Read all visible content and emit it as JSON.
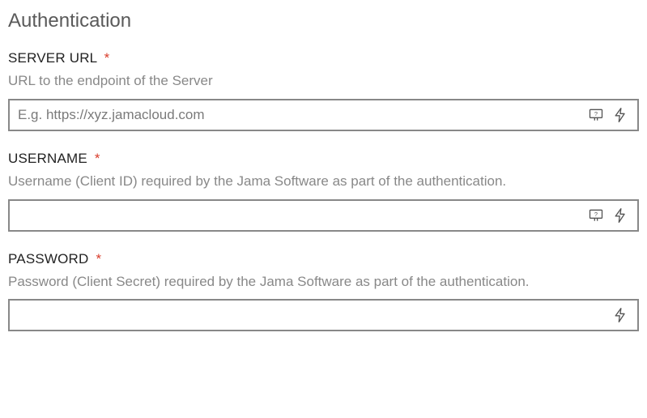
{
  "section": {
    "title": "Authentication"
  },
  "fields": {
    "server_url": {
      "label": "SERVER URL",
      "required_mark": "*",
      "description": "URL to the endpoint of the Server",
      "placeholder": "E.g. https://xyz.jamacloud.com",
      "value": ""
    },
    "username": {
      "label": "USERNAME",
      "required_mark": "*",
      "description": "Username (Client ID) required by the Jama Software as part of the authentication.",
      "placeholder": "",
      "value": ""
    },
    "password": {
      "label": "PASSWORD",
      "required_mark": "*",
      "description": "Password (Client Secret) required by the Jama Software as part of the authentication.",
      "placeholder": "",
      "value": ""
    }
  }
}
